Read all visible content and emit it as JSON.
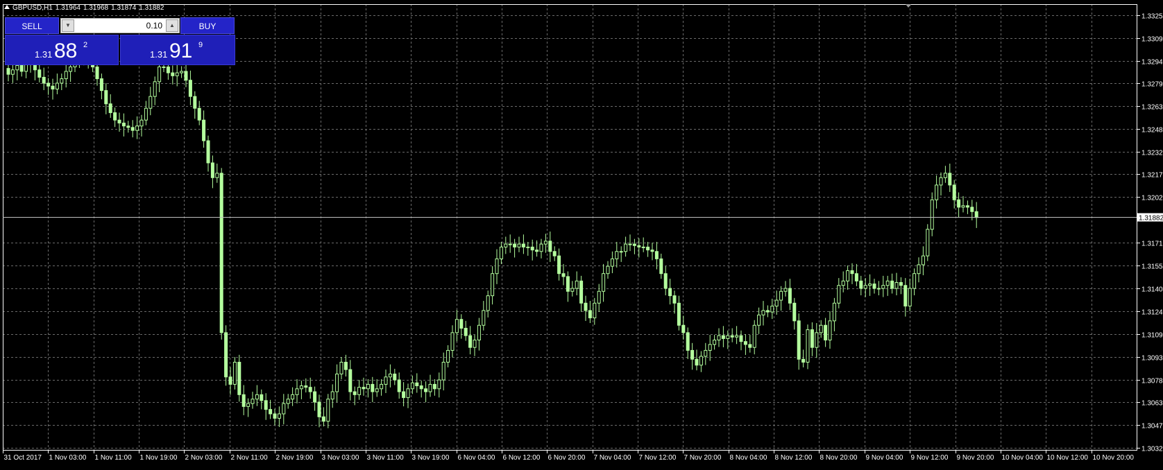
{
  "header": {
    "symbol": "GBPUSD,H1",
    "open": "1.31964",
    "high": "1.31968",
    "low": "1.31874",
    "close": "1.31882"
  },
  "trade_panel": {
    "sell_label": "SELL",
    "buy_label": "BUY",
    "lot_value": "0.10",
    "sell_price_prefix": "1.31",
    "sell_price_big": "88",
    "sell_price_sup": "2",
    "buy_price_prefix": "1.31",
    "buy_price_big": "91",
    "buy_price_sup": "9"
  },
  "colors": {
    "background": "#000000",
    "grid": "#6b6b6b",
    "axis": "#ffffff",
    "candle": "#b4ff9e",
    "bid_line": "#c0c0c0",
    "trade_button": "#2424c8"
  },
  "chart_data": {
    "type": "candlestick",
    "timeframe": "H1",
    "ylim": [
      1.3032,
      1.3325
    ],
    "y_ticks": [
      "1.33250",
      "1.33095",
      "1.32940",
      "1.32790",
      "1.32635",
      "1.32480",
      "1.32325",
      "1.32175",
      "1.32020",
      "1.31710",
      "1.31555",
      "1.31400",
      "1.31245",
      "1.31090",
      "1.30935",
      "1.30780",
      "1.30630",
      "1.30475",
      "1.30320"
    ],
    "current_price": "1.31882",
    "x_ticks": [
      "31 Oct 2017",
      "1 Nov 03:00",
      "1 Nov 11:00",
      "1 Nov 19:00",
      "2 Nov 03:00",
      "2 Nov 11:00",
      "2 Nov 19:00",
      "3 Nov 03:00",
      "3 Nov 11:00",
      "3 Nov 19:00",
      "6 Nov 04:00",
      "6 Nov 12:00",
      "6 Nov 20:00",
      "7 Nov 04:00",
      "7 Nov 12:00",
      "7 Nov 20:00",
      "8 Nov 04:00",
      "8 Nov 12:00",
      "8 Nov 20:00",
      "9 Nov 04:00",
      "9 Nov 12:00",
      "9 Nov 20:00",
      "10 Nov 04:00",
      "10 Nov 12:00",
      "10 Nov 20:00"
    ],
    "close_path": [
      1.3285,
      1.3288,
      1.3291,
      1.3287,
      1.3292,
      1.3294,
      1.3288,
      1.3283,
      1.3279,
      1.3277,
      1.3275,
      1.3279,
      1.3282,
      1.3287,
      1.329,
      1.3294,
      1.3297,
      1.33,
      1.3296,
      1.329,
      1.3282,
      1.3274,
      1.3265,
      1.3259,
      1.3254,
      1.3252,
      1.325,
      1.3249,
      1.3247,
      1.325,
      1.3254,
      1.3262,
      1.327,
      1.328,
      1.329,
      1.329,
      1.3286,
      1.3284,
      1.3286,
      1.3287,
      1.3281,
      1.327,
      1.3262,
      1.3254,
      1.324,
      1.3225,
      1.3215,
      1.3218,
      1.311,
      1.308,
      1.3075,
      1.309,
      1.3068,
      1.306,
      1.3062,
      1.3065,
      1.3068,
      1.3064,
      1.3058,
      1.3055,
      1.3052,
      1.3055,
      1.3062,
      1.3065,
      1.3068,
      1.3072,
      1.3074,
      1.3073,
      1.307,
      1.3063,
      1.3053,
      1.305,
      1.3065,
      1.307,
      1.3082,
      1.309,
      1.3085,
      1.307,
      1.3068,
      1.3073,
      1.3072,
      1.3075,
      1.307,
      1.3072,
      1.3075,
      1.308,
      1.3082,
      1.3078,
      1.307,
      1.3066,
      1.3072,
      1.3076,
      1.3074,
      1.3072,
      1.307,
      1.3075,
      1.3072,
      1.3078,
      1.309,
      1.3098,
      1.311,
      1.3119,
      1.3113,
      1.3108,
      1.31,
      1.3105,
      1.3115,
      1.3125,
      1.3135,
      1.315,
      1.316,
      1.3168,
      1.317,
      1.317,
      1.3168,
      1.317,
      1.3168,
      1.3168,
      1.3166,
      1.3165,
      1.317,
      1.3172,
      1.3165,
      1.3162,
      1.315,
      1.3148,
      1.3138,
      1.314,
      1.3145,
      1.313,
      1.3125,
      1.312,
      1.313,
      1.3138,
      1.315,
      1.3155,
      1.316,
      1.3165,
      1.3165,
      1.317,
      1.317,
      1.3169,
      1.3168,
      1.3168,
      1.3166,
      1.3165,
      1.316,
      1.315,
      1.314,
      1.3135,
      1.313,
      1.3115,
      1.311,
      1.3098,
      1.3092,
      1.3088,
      1.3094,
      1.3098,
      1.3102,
      1.3105,
      1.3108,
      1.3106,
      1.3108,
      1.3107,
      1.3108,
      1.3104,
      1.3102,
      1.31,
      1.3115,
      1.3122,
      1.3125,
      1.3124,
      1.3128,
      1.3132,
      1.3138,
      1.314,
      1.313,
      1.3118,
      1.3092,
      1.309,
      1.3112,
      1.31,
      1.311,
      1.3115,
      1.3105,
      1.3118,
      1.313,
      1.3142,
      1.3145,
      1.3152,
      1.315,
      1.3145,
      1.314,
      1.3142,
      1.3143,
      1.314,
      1.314,
      1.3142,
      1.3145,
      1.314,
      1.3144,
      1.3142,
      1.3128,
      1.314,
      1.315,
      1.3156,
      1.3162,
      1.318,
      1.32,
      1.321,
      1.3215,
      1.3218,
      1.321,
      1.32,
      1.3195,
      1.3196,
      1.3195,
      1.3192,
      1.3188
    ]
  }
}
